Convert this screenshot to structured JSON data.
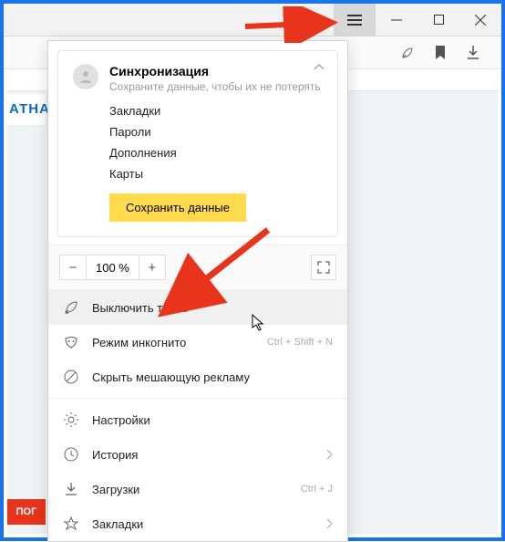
{
  "titlebar": {
    "tabs_icon": "tabs",
    "menu_icon": "hamburger",
    "min_icon": "minimize",
    "max_icon": "maximize",
    "close_icon": "close"
  },
  "tabsbar": {
    "rocket_icon": "rocket",
    "bookmark_icon": "bookmark",
    "download_icon": "download"
  },
  "left_text": "АТНА",
  "red_text": "ПОГ",
  "sync": {
    "title": "Синхронизация",
    "subtitle": "Сохраните данные, чтобы их не потерять",
    "links": [
      "Закладки",
      "Пароли",
      "Дополнения",
      "Карты"
    ],
    "save_button": "Сохранить данные"
  },
  "zoom": {
    "minus": "−",
    "value": "100 %",
    "plus": "+"
  },
  "items": {
    "turbo": {
      "label": "Выключить турбо"
    },
    "incognito": {
      "label": "Режим инкогнито",
      "shortcut": "Ctrl + Shift + N"
    },
    "adblock": {
      "label": "Скрыть мешающую рекламу"
    },
    "settings": {
      "label": "Настройки"
    },
    "history": {
      "label": "История"
    },
    "downloads": {
      "label": "Загрузки",
      "shortcut": "Ctrl + J"
    },
    "bookmarks": {
      "label": "Закладки"
    }
  }
}
